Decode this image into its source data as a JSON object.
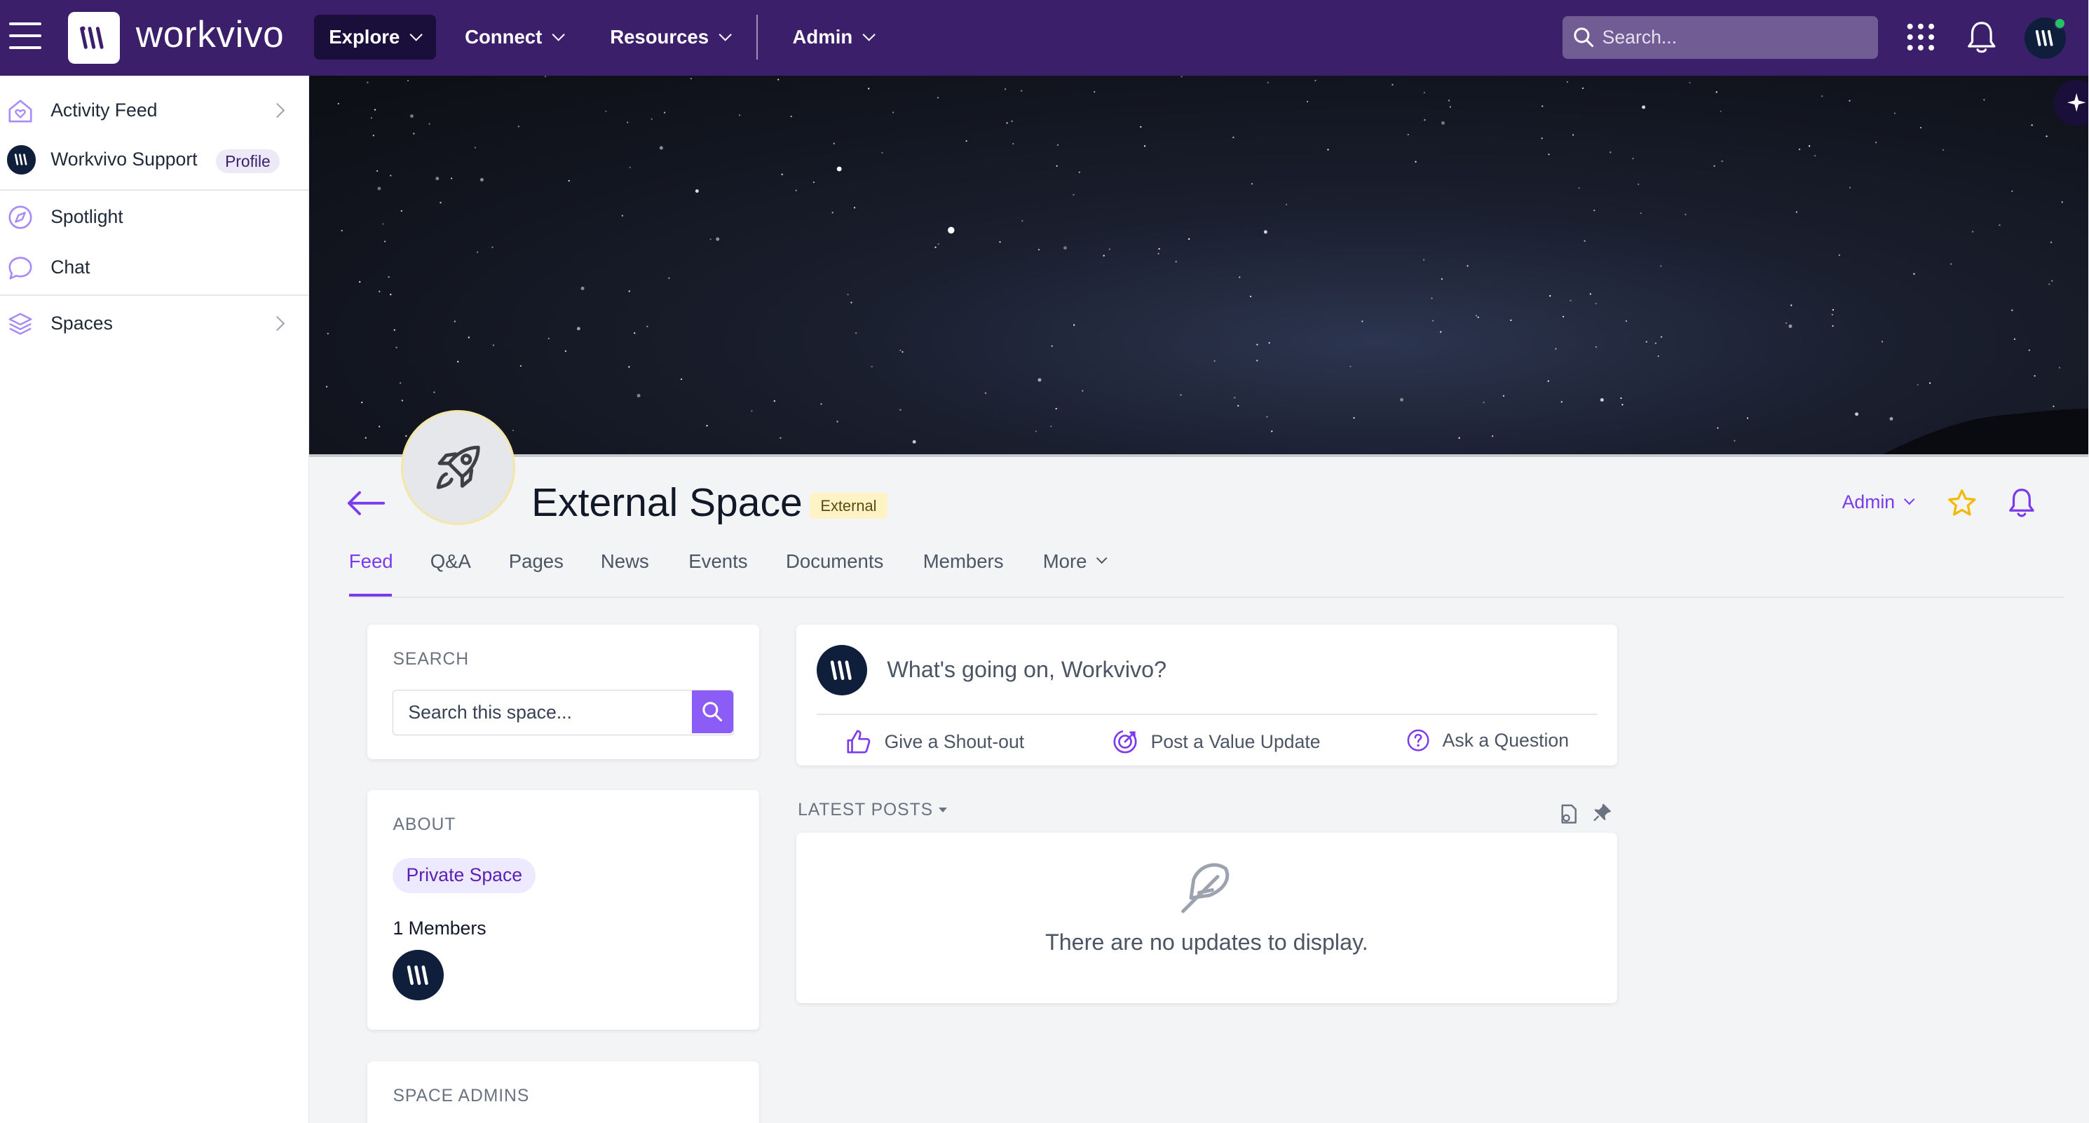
{
  "topbar": {
    "brand": "workvivo",
    "nav": [
      "Explore",
      "Connect",
      "Resources",
      "Admin"
    ],
    "search_placeholder": "Search..."
  },
  "sidebar": {
    "items": [
      {
        "label": "Activity Feed"
      },
      {
        "label": "Workvivo Support",
        "badge": "Profile"
      },
      {
        "label": "Spotlight"
      },
      {
        "label": "Chat"
      },
      {
        "label": "Spaces"
      }
    ]
  },
  "space": {
    "title": "External Space",
    "badge": "External",
    "admin_label": "Admin"
  },
  "tabs": [
    "Feed",
    "Q&A",
    "Pages",
    "News",
    "Events",
    "Documents",
    "Members",
    "More"
  ],
  "search_card": {
    "label": "SEARCH",
    "placeholder": "Search this space..."
  },
  "about_card": {
    "label": "ABOUT",
    "privacy": "Private Space",
    "members": "1 Members"
  },
  "admins_card": {
    "label": "SPACE ADMINS"
  },
  "composer": {
    "prompt": "What's going on, Workvivo?",
    "actions": [
      "Give a Shout-out",
      "Post a Value Update",
      "Ask a Question"
    ]
  },
  "feed": {
    "label": "LATEST POSTS",
    "empty": "There are no updates to display."
  },
  "colors": {
    "topbar": "#3b1f6b",
    "accent": "#7c3aed",
    "star": "#f5b800"
  }
}
